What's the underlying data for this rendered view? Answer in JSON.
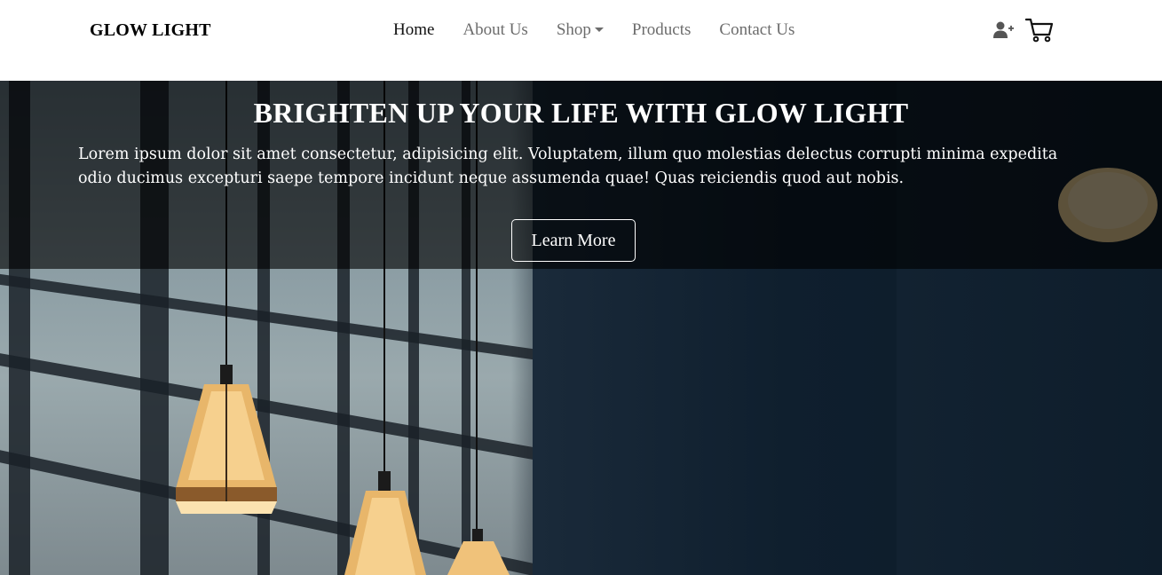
{
  "navbar": {
    "brand": "GLOW LIGHT",
    "links": [
      {
        "label": "Home",
        "active": true
      },
      {
        "label": "About Us",
        "active": false
      },
      {
        "label": "Shop",
        "active": false
      },
      {
        "label": "Products",
        "active": false
      },
      {
        "label": "Contact Us",
        "active": false
      }
    ],
    "icons": [
      "user-plus-icon",
      "cart-icon"
    ]
  },
  "hero": {
    "title": "BRIGHTEN UP YOUR LIFE WITH GLOW LIGHT",
    "text": "Lorem ipsum dolor sit amet consectetur, adipisicing elit. Voluptatem, illum quo molestias delectus corrupti minima expedita odio ducimus excepturi saepe tempore incidunt neque assumenda quae! Quas reiciendis quod aut nobis.",
    "button_label": "Learn More"
  },
  "colors": {
    "overlay": "#000000",
    "text_light": "#ffffff",
    "nav_muted": "#6c6c6c",
    "lamp_glow": "#f3c47a"
  }
}
